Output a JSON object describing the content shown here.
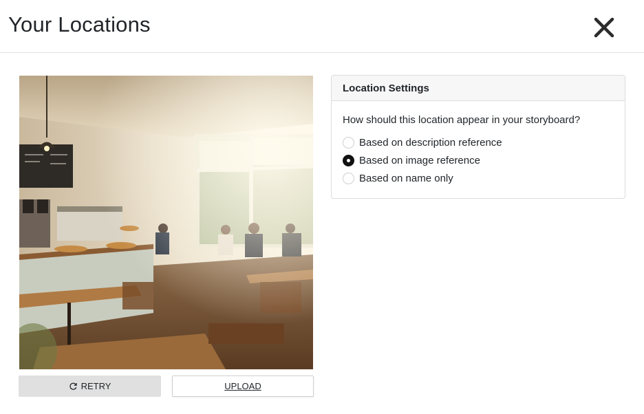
{
  "header": {
    "title": "Your Locations",
    "close_icon": "close-x-icon"
  },
  "location_image": {
    "description_hidden": true,
    "icon": "location-photo"
  },
  "buttons": {
    "retry_label": "RETRY",
    "retry_icon": "refresh-icon",
    "upload_label": "UPLOAD"
  },
  "settings": {
    "title": "Location Settings",
    "question": "How should this location appear in your storyboard?",
    "options": [
      {
        "label": "Based on description reference",
        "checked": false
      },
      {
        "label": "Based on image reference",
        "checked": true
      },
      {
        "label": "Based on name only",
        "checked": false
      }
    ]
  },
  "colors": {
    "border": "#dee2e6",
    "retry_bg": "#e0e0e0",
    "card_header_bg": "#f7f7f7",
    "radio_checked": "#111111"
  }
}
